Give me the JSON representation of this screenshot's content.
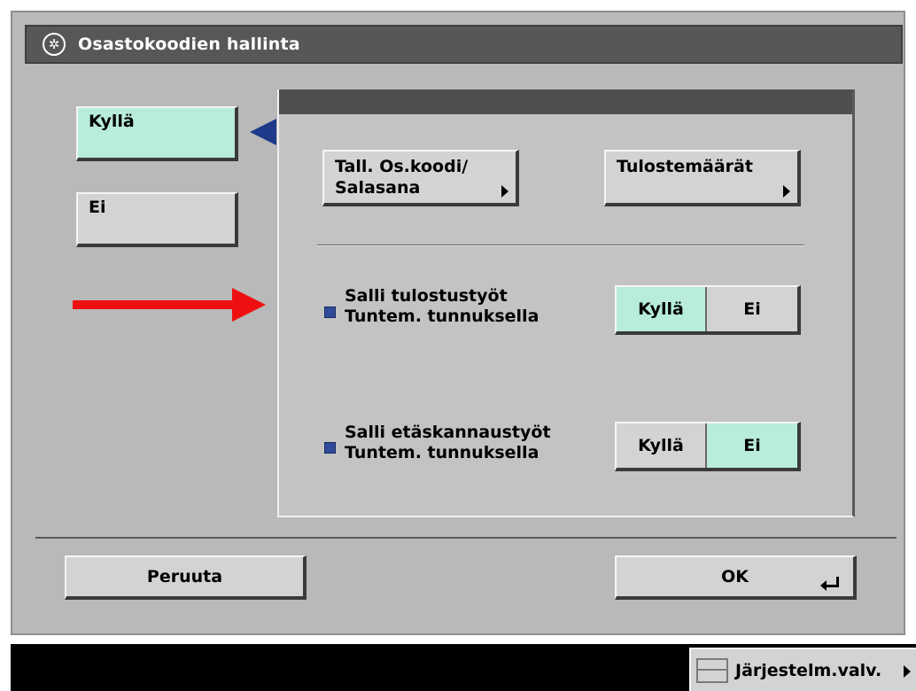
{
  "window": {
    "title": "Osastokoodien hallinta",
    "icon": "department-id-icon"
  },
  "side_options": [
    {
      "label": "Kyllä",
      "selected": true
    },
    {
      "label": "Ei",
      "selected": false
    }
  ],
  "panel": {
    "register_button": {
      "line1": "Tall. Os.koodi/",
      "line2": "Salasana"
    },
    "print_limits_button": "Tulostemäärät",
    "options": [
      {
        "line1": "Salli tulostustyöt",
        "line2": "Tuntem. tunnuksella",
        "yes": "Kyllä",
        "no": "Ei",
        "selected": "Kyllä"
      },
      {
        "line1": "Salli etäskannaustyöt",
        "line2": "Tuntem. tunnuksella",
        "yes": "Kyllä",
        "no": "Ei",
        "selected": "Ei"
      }
    ]
  },
  "footer": {
    "cancel": "Peruuta",
    "ok": "OK"
  },
  "status": {
    "system_monitor": "Järjestelm.valv."
  },
  "colors": {
    "selected": "#b8ecdc",
    "button": "#d3d3d3",
    "title_bar": "#575757",
    "annotation_arrow": "#ee1010",
    "bullet": "#2f4a9a"
  }
}
